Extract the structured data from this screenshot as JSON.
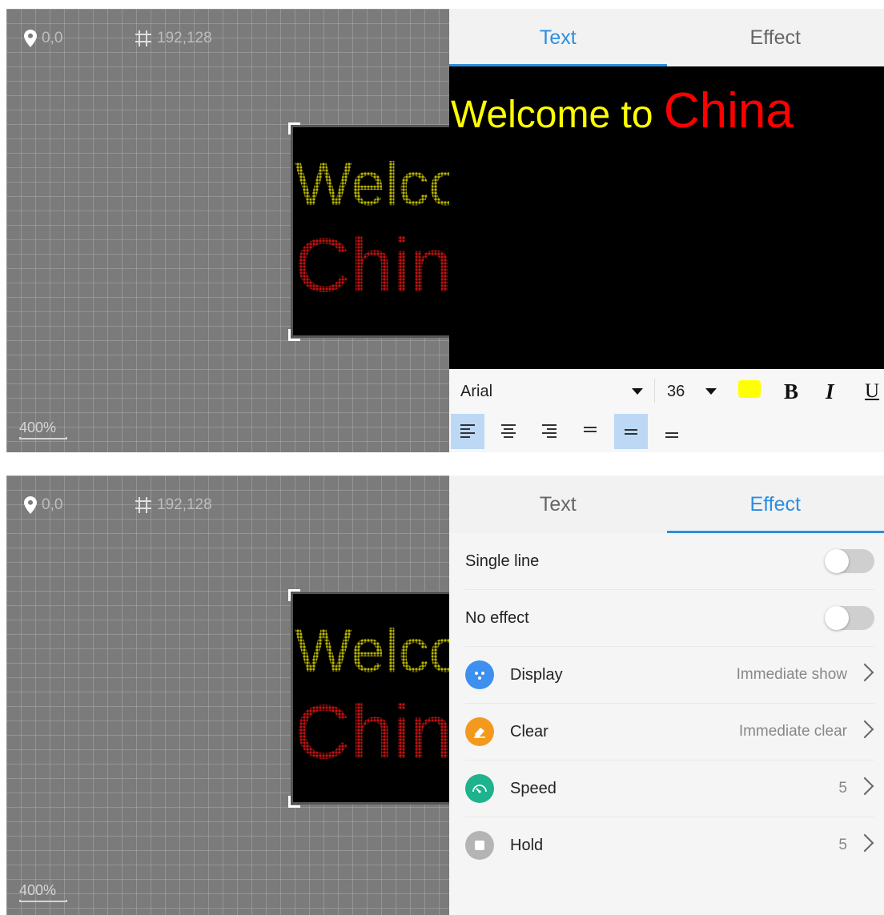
{
  "canvas": {
    "position": "0,0",
    "size": "192,128",
    "zoom": "400%",
    "led_line1": "Welco",
    "led_line2": "Chin"
  },
  "tabs": {
    "text": "Text",
    "effect": "Effect"
  },
  "preview": {
    "part1": "Welcome to ",
    "part2": "China",
    "color1": "#ffff00",
    "color2": "#ff0000"
  },
  "toolbar": {
    "font": "Arial",
    "size": "36",
    "color": "#ffff00",
    "bold": "B",
    "italic": "I",
    "underline": "U",
    "align_selected": [
      "left",
      "middle"
    ]
  },
  "effect": {
    "single_line": {
      "label": "Single line",
      "on": false
    },
    "no_effect": {
      "label": "No effect",
      "on": false
    },
    "display": {
      "label": "Display",
      "value": "Immediate show",
      "icon": "display-dots-icon",
      "color": "#3d8ff0"
    },
    "clear": {
      "label": "Clear",
      "value": "Immediate clear",
      "icon": "eraser-icon",
      "color": "#f39a1e"
    },
    "speed": {
      "label": "Speed",
      "value": "5",
      "icon": "speedometer-icon",
      "color": "#1db38c"
    },
    "hold": {
      "label": "Hold",
      "value": "5",
      "icon": "stop-icon",
      "color": "#b4b4b4"
    }
  }
}
